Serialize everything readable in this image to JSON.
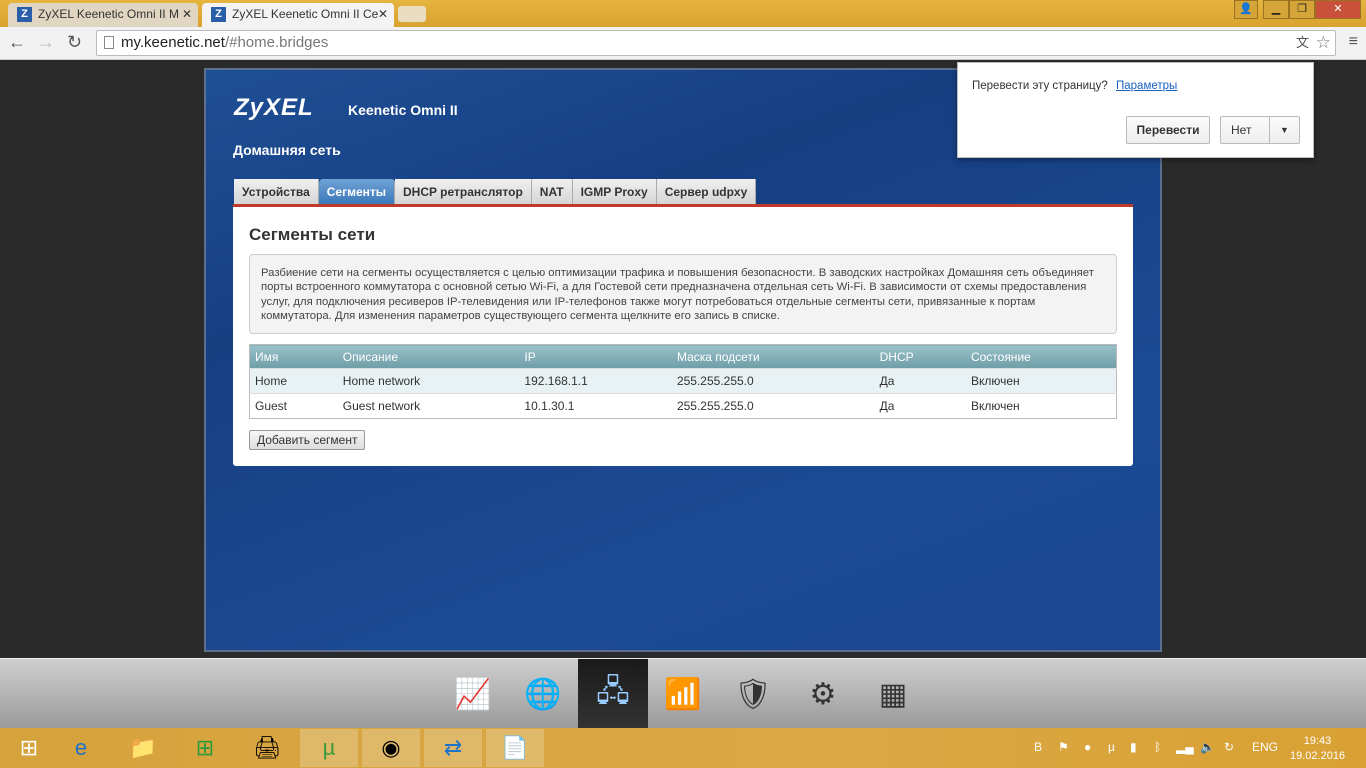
{
  "browser": {
    "tabs": [
      {
        "title": "ZyXEL Keenetic Omni II M"
      },
      {
        "title": "ZyXEL Keenetic Omni II Ce"
      }
    ],
    "url_host": "my.keenetic.net",
    "url_path": "/#home.bridges"
  },
  "translate": {
    "question": "Перевести эту страницу?",
    "options_link": "Параметры",
    "translate_button": "Перевести",
    "no_button": "Нет"
  },
  "router": {
    "logo": "ZyXEL",
    "model": "Keenetic Omni II",
    "section": "Домашняя сеть",
    "tabs": [
      {
        "label": "Устройства"
      },
      {
        "label": "Сегменты"
      },
      {
        "label": "DHCP ретранслятор"
      },
      {
        "label": "NAT"
      },
      {
        "label": "IGMP Proxy"
      },
      {
        "label": "Сервер udpxy"
      }
    ],
    "active_tab": "Сегменты",
    "panel_title": "Сегменты сети",
    "info": "Разбиение сети на сегменты осуществляется с целью оптимизации трафика и повышения безопасности. В заводских настройках Домашняя сеть объединяет порты встроенного коммутатора с основной сетью Wi-Fi, а для Гостевой сети предназначена отдельная сеть Wi-Fi. В зависимости от схемы предоставления услуг, для подключения ресиверов IP-телевидения или IP-телефонов также могут потребоваться отдельные сегменты сети, привязанные к портам коммутатора. Для изменения параметров существующего сегмента щелкните его запись в списке.",
    "columns": [
      "Имя",
      "Описание",
      "IP",
      "Маска подсети",
      "DHCP",
      "Состояние"
    ],
    "rows": [
      [
        "Home",
        "Home network",
        "192.168.1.1",
        "255.255.255.0",
        "Да",
        "Включен"
      ],
      [
        "Guest",
        "Guest network",
        "10.1.30.1",
        "255.255.255.0",
        "Да",
        "Включен"
      ]
    ],
    "add_button": "Добавить сегмент"
  },
  "dock": [
    "monitor-icon",
    "internet-icon",
    "home-network-icon",
    "wifi-icon",
    "security-icon",
    "system-icon",
    "apps-icon"
  ],
  "taskbar": {
    "lang": "ENG",
    "time": "19:43",
    "date": "19.02.2016"
  }
}
